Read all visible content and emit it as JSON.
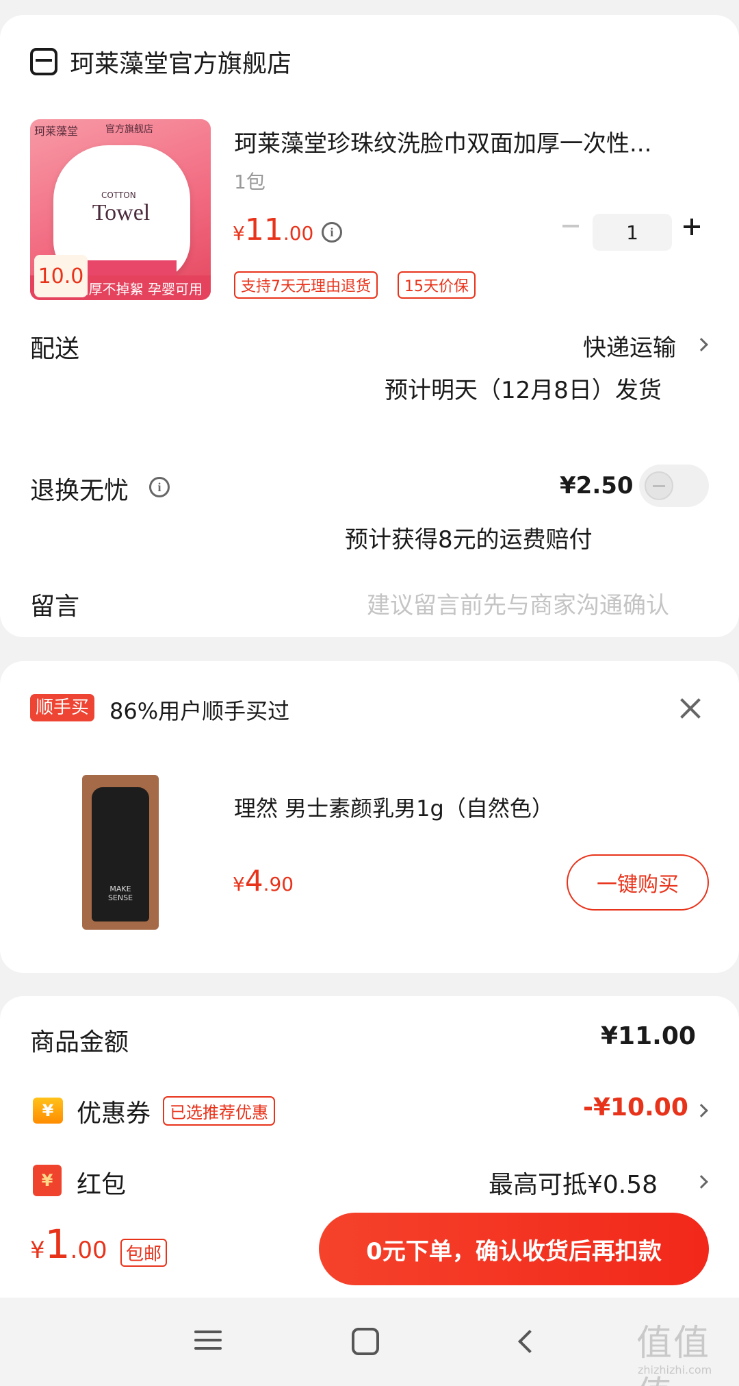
{
  "store": {
    "name": "珂莱藻堂官方旗舰店"
  },
  "product": {
    "title": "珂莱藻堂珍珠纹洗脸巾双面加厚一次性...",
    "spec": "1包",
    "price_symbol": "¥",
    "price_int": "11",
    "price_dec": ".00",
    "quantity": "1",
    "tags": [
      "支持7天无理由退货",
      "15天价保"
    ],
    "image": {
      "brand_left": "珂莱藻堂",
      "brand_right": "官方旗舰店",
      "bag_text": "Towel",
      "bag_sub": "COTTON",
      "badge": "10.0",
      "bottom_text": "加厚不掉絮 孕婴可用"
    }
  },
  "delivery": {
    "label": "配送",
    "method": "快递运输",
    "estimate": "预计明天（12月8日）发货"
  },
  "return_insurance": {
    "label": "退换无忧",
    "price": "¥2.50",
    "note": "预计获得8元的运费赔付",
    "enabled": false
  },
  "message": {
    "label": "留言",
    "placeholder": "建议留言前先与商家沟通确认"
  },
  "addon": {
    "badge": "顺手买",
    "headline": "86%用户顺手买过",
    "item_title": "理然 男士素颜乳男1g（自然色）",
    "price_symbol": "¥",
    "price_int": "4",
    "price_dec": ".90",
    "buy_label": "一键购买",
    "image_text": "MAKE SENSE"
  },
  "summary": {
    "goods_label": "商品金额",
    "goods_value": "¥11.00",
    "coupon_label": "优惠券",
    "coupon_tag": "已选推荐优惠",
    "coupon_value": "-¥10.00",
    "redpack_label": "红包",
    "redpack_value": "最高可抵¥0.58",
    "icon_symbol": "¥"
  },
  "footer": {
    "total_symbol": "¥",
    "total_int": "1",
    "total_dec": ".00",
    "shipping_tag": "包邮",
    "submit_label": "0元下单，确认收货后再扣款"
  },
  "watermark": {
    "main": "值值值",
    "sub": "zhizhizhi.com"
  },
  "colors": {
    "accent": "#e8331b",
    "background": "#f2f2f2"
  }
}
